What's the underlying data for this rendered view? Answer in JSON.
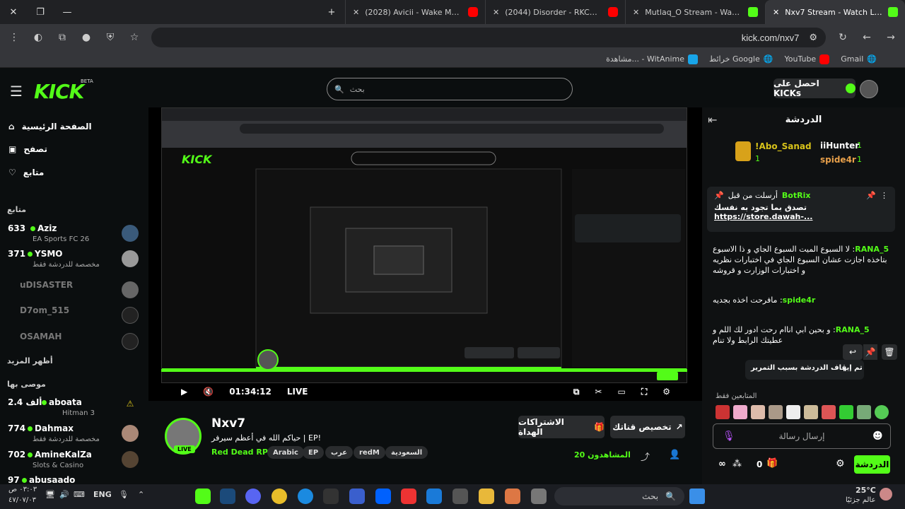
{
  "browser": {
    "tabs": [
      {
        "title": "(2028) Avicii - Wake Me Up (Offi",
        "icon": "youtube"
      },
      {
        "title": "(2044) Disorder - RKCB (Official",
        "icon": "youtube"
      },
      {
        "title": "Mutlaq_O Stream - Watch Live",
        "icon": "kick"
      },
      {
        "title": "Nxv7 Stream - Watch Live on Ki",
        "icon": "kick"
      }
    ],
    "url": "kick.com/nxv7",
    "bookmarks": [
      "Gmail",
      "YouTube",
      "خرائط Google",
      "مشاهدة... - WitAnime"
    ]
  },
  "header": {
    "logo": "KICK",
    "beta": "BETA",
    "search_placeholder": "بحث",
    "get_kicks": "احصل على KICKs"
  },
  "sidebar": {
    "nav": [
      "الصفحة الرئيسية",
      "تصفح",
      "متابع"
    ],
    "following_title": "متابع",
    "following": [
      {
        "viewers": "633",
        "name": "Aziz",
        "category": "EA Sports FC 26"
      },
      {
        "viewers": "371",
        "name": "YSMO",
        "category": "مخصصة للدردشة فقط"
      },
      {
        "viewers": "",
        "name": "uDISASTER",
        "category": ""
      },
      {
        "viewers": "",
        "name": "D7om_515",
        "category": ""
      },
      {
        "viewers": "",
        "name": "OSAMAH",
        "category": ""
      }
    ],
    "show_more": "أظهر المزيد",
    "recommended_title": "موصى بها",
    "recommended": [
      {
        "viewers": "2.4 ألف",
        "name": "aboata",
        "category": "Hitman 3"
      },
      {
        "viewers": "774",
        "name": "Dahmax",
        "category": "مخصصة للدردشة فقط"
      },
      {
        "viewers": "702",
        "name": "AmineKalZa",
        "category": "Slots & Casino"
      },
      {
        "viewers": "97",
        "name": "abusaado",
        "category": ""
      }
    ]
  },
  "player": {
    "time": "01:34:12",
    "live": "LIVE",
    "progress": 1.0
  },
  "channel": {
    "name": "Nxv7",
    "title": "حياكم الله في أعظم سيرفر | EP!",
    "category": "Red Dead RP",
    "tags": [
      "Arabic",
      "EP",
      "عرب",
      "redM",
      "السعودية"
    ],
    "live_badge": "LIVE",
    "subscribe_label": "تخصيص قناتك",
    "gift_label": "الاشتراكات الهداة",
    "viewers": "20 المشاهدون"
  },
  "chat": {
    "title": "الدردشة",
    "gifters": [
      {
        "name": "!Abo_Sanad",
        "count": "1"
      },
      {
        "name": "iiHunter",
        "count": "1"
      },
      {
        "name": "spide4r",
        "count": "1"
      }
    ],
    "pinned": {
      "sender": "BotRix",
      "label": "أرسلت من قبل",
      "text": "تصدق بما تجود به نفسك",
      "link": "https://store.dawah-..."
    },
    "messages": [
      {
        "user": "5_RANA",
        "text": "لا السبوع الميت السبوع الجاي و ذا الاسبوع بتاخذه اجازت عشان السبوع الجاي في اختبارات نظريه و اختبارات الوزارت و قروشه"
      },
      {
        "user": "spide4r",
        "text": "مافرحت اخذه بجديه"
      },
      {
        "user": "5_RANA",
        "text": "و بحين ابي اناام رحت ادور لك اللم و عطيتك الرابط ولا تنام"
      }
    ],
    "paused": "تم إيقاف الدردشة بسبب التمرير",
    "followers_only": "المتابعين فقط",
    "input_placeholder": "إرسال رسالة",
    "send_label": "الدردشة",
    "points": "0"
  },
  "taskbar": {
    "time": "٠٣:٠٣ ص",
    "date": "٤٧/٠٧/٠٣",
    "lang": "ENG",
    "temp": "25°C",
    "weather": "عالم جزئيًا",
    "search": "بحث"
  }
}
